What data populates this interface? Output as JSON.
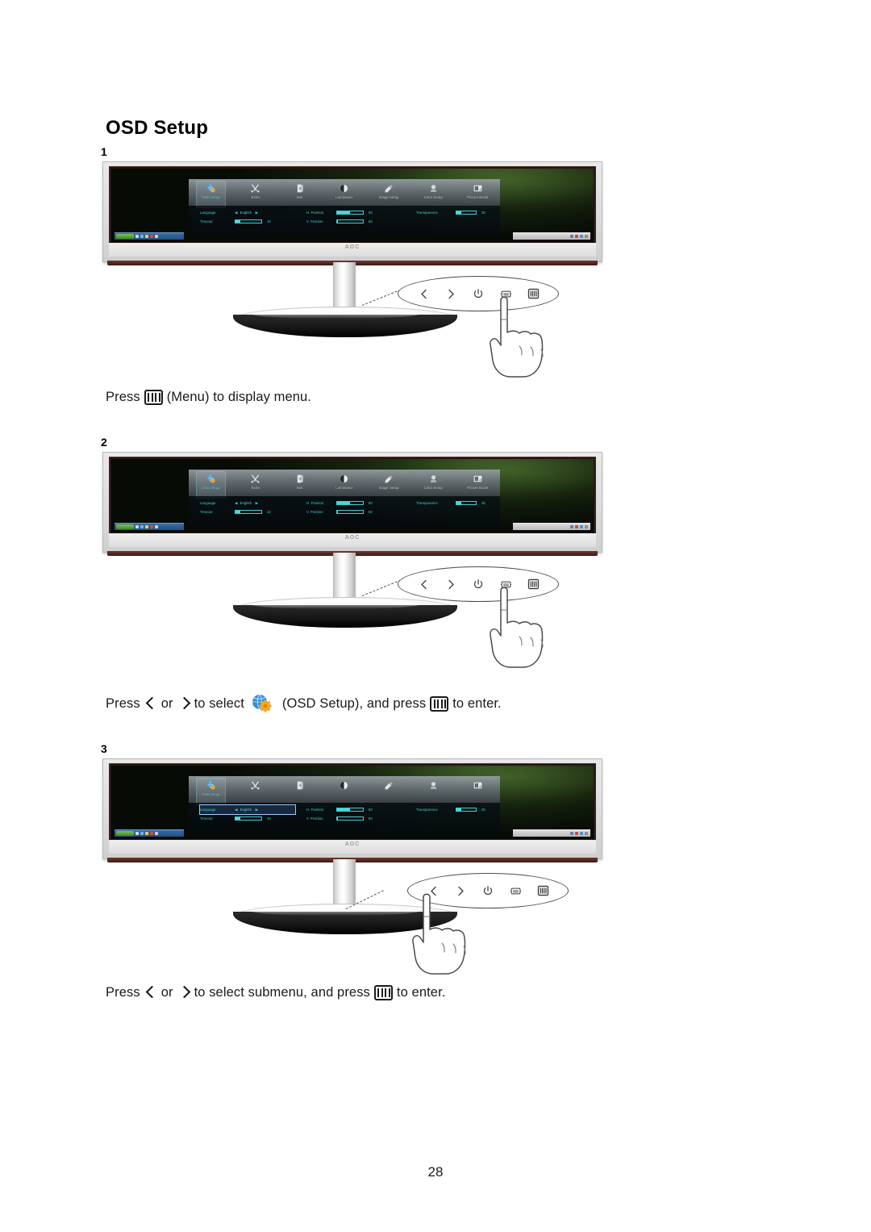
{
  "document": {
    "title": "OSD Setup",
    "page_number": "28"
  },
  "steps": [
    {
      "number": "1",
      "caption_pre": "Press",
      "caption_post": "(Menu) to display menu.",
      "pressed_button": "menu",
      "selected_row": null
    },
    {
      "number": "2",
      "caption_pre": "Press",
      "caption_mid": "or",
      "caption_sel": "to select",
      "caption_item": "(OSD Setup), and press",
      "caption_post": "to enter.",
      "pressed_button": "menu",
      "selected_row": null
    },
    {
      "number": "3",
      "caption_pre": "Press",
      "caption_mid": "or",
      "caption_sel": "to select submenu, and press",
      "caption_post": "to enter.",
      "pressed_button": "left",
      "selected_row": "Language"
    }
  ],
  "osd": {
    "brand": "AOC",
    "tabs": [
      {
        "label": "OSD Setup",
        "icon": "globe-gear-icon",
        "active": true
      },
      {
        "label": "Extra",
        "icon": "tools-icon",
        "active": false
      },
      {
        "label": "Exit",
        "icon": "exit-door-icon",
        "active": false
      },
      {
        "label": "Luminance",
        "icon": "contrast-icon",
        "active": false
      },
      {
        "label": "Image Setup",
        "icon": "image-setup-icon",
        "active": false
      },
      {
        "label": "Color Setup",
        "icon": "color-setup-icon",
        "active": false
      },
      {
        "label": "Picture Boost",
        "icon": "picture-boost-icon",
        "active": false
      }
    ],
    "settings": {
      "column1": [
        {
          "label": "Language",
          "type": "spinner",
          "value": "English",
          "left_arrow": "◀",
          "right_arrow": "▶"
        },
        {
          "label": "Timeout",
          "type": "slider",
          "value": "10",
          "fill_percent": 18
        }
      ],
      "column2": [
        {
          "label": "H. Position",
          "type": "slider",
          "value": "50",
          "fill_percent": 50
        },
        {
          "label": "V. Position",
          "type": "slider",
          "value": "50",
          "fill_percent": 3
        }
      ],
      "column3": [
        {
          "label": "Transparence",
          "type": "slider",
          "value": "25",
          "fill_percent": 25
        }
      ]
    }
  },
  "control_panel": {
    "buttons": [
      {
        "name": "left",
        "glyph": "<",
        "label": "Left"
      },
      {
        "name": "right",
        "glyph": ">",
        "label": "Right"
      },
      {
        "name": "power",
        "glyph": "power",
        "label": "Power"
      },
      {
        "name": "source",
        "glyph": "source",
        "label": "Auto / Source"
      },
      {
        "name": "menu",
        "glyph": "menu",
        "label": "Menu"
      }
    ]
  }
}
